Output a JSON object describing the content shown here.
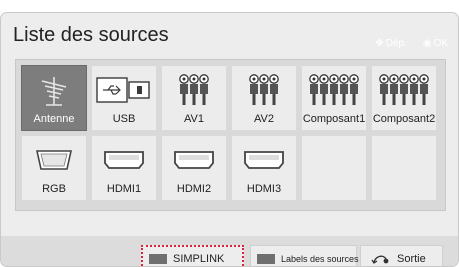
{
  "header": {
    "title": "Liste des sources",
    "hint_move": "Dép.",
    "hint_ok": "OK"
  },
  "sources": [
    {
      "label": "Antenne",
      "icon": "antenna-icon",
      "selected": true
    },
    {
      "label": "USB",
      "icon": "usb-icon",
      "selected": false
    },
    {
      "label": "AV1",
      "icon": "rca-3-icon",
      "selected": false
    },
    {
      "label": "AV2",
      "icon": "rca-3-icon",
      "selected": false
    },
    {
      "label": "Composant1",
      "icon": "rca-5-icon",
      "selected": false
    },
    {
      "label": "Composant2",
      "icon": "rca-5-icon",
      "selected": false
    },
    {
      "label": "RGB",
      "icon": "vga-icon",
      "selected": false
    },
    {
      "label": "HDMI1",
      "icon": "hdmi-icon",
      "selected": false
    },
    {
      "label": "HDMI2",
      "icon": "hdmi-icon",
      "selected": false
    },
    {
      "label": "HDMI3",
      "icon": "hdmi-icon",
      "selected": false
    },
    {
      "label": "",
      "icon": "",
      "selected": false
    },
    {
      "label": "",
      "icon": "",
      "selected": false
    }
  ],
  "footer": {
    "simplink": "SIMPLINK",
    "labels": "Labels des sources",
    "exit": "Sortie"
  },
  "colors": {
    "selected_tile": "#7d7d7d",
    "simplink_border": "#d8243c",
    "panel": "#ededed"
  }
}
